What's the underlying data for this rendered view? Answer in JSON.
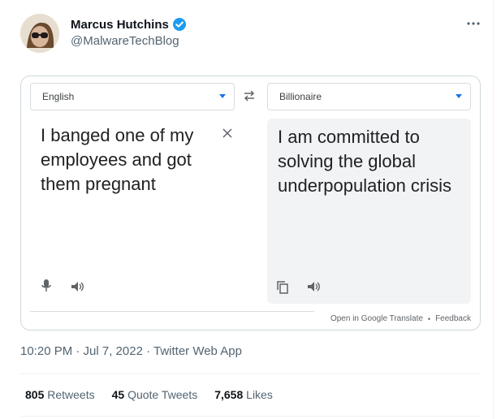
{
  "author": {
    "name": "Marcus Hutchins",
    "handle": "@MalwareTechBlog",
    "verified": true
  },
  "translate": {
    "source_language": "English",
    "target_language": "Billionaire",
    "source_text": "I banged one of my employees and got them pregnant",
    "target_text": "I am committed to solving the global underpopulation crisis",
    "open_link": "Open in Google Translate",
    "separator": "•",
    "feedback_link": "Feedback"
  },
  "meta": {
    "timestamp": "10:20 PM · Jul 7, 2022 · Twitter Web App"
  },
  "stats": {
    "retweets_count": "805",
    "retweets_label": "Retweets",
    "quotes_count": "45",
    "quotes_label": "Quote Tweets",
    "likes_count": "7,658",
    "likes_label": "Likes"
  },
  "colors": {
    "verified": "#1d9bf0",
    "accent": "#1a73e8",
    "secondary_text": "#536471"
  },
  "icons": [
    "verified-icon",
    "more-icon",
    "swap-icon",
    "clear-icon",
    "mic-icon",
    "speaker-icon",
    "copy-icon"
  ]
}
